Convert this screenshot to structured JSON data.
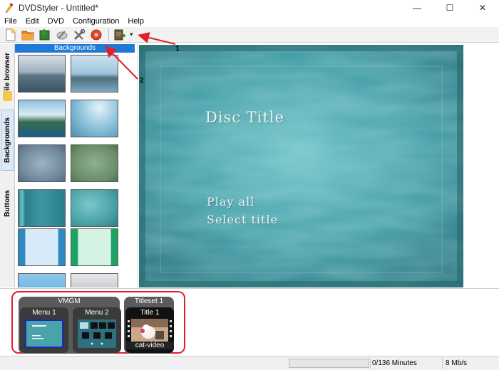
{
  "window": {
    "title": "DVDStyler - Untitled*"
  },
  "window_controls": {
    "minimize": "—",
    "maximize": "☐",
    "close": "✕"
  },
  "menu": [
    "File",
    "Edit",
    "DVD",
    "Configuration",
    "Help"
  ],
  "toolbar": {
    "buttons": [
      "new-file-icon",
      "open-folder-icon",
      "save-icon",
      "burn-disc-icon",
      "settings-tools-icon",
      "burn-dvd-icon",
      "add-video-icon"
    ],
    "dropdown_arrow": "▾"
  },
  "sidebar": {
    "tabs": [
      {
        "label": "File browser",
        "active": false
      },
      {
        "label": "Backgrounds",
        "active": true
      },
      {
        "label": "Buttons",
        "active": false
      }
    ]
  },
  "backgrounds_panel": {
    "header": "Backgrounds",
    "thumbnails": [
      "coast-cloudy",
      "coast-island",
      "green-shore",
      "blue-haze",
      "blue-gray-blur",
      "green-blur",
      "teal-stripes",
      "teal-texture",
      "light-blue-frame",
      "mint-green-frame",
      "blue-gradient",
      "gray-gradient"
    ]
  },
  "preview": {
    "disc_title": "Disc Title",
    "play_all": "Play all",
    "select_title": "Select title"
  },
  "titleset_manager": {
    "vmgm": {
      "label": "VMGM",
      "menus": [
        "Menu 1"
      ]
    },
    "titleset": {
      "label": "Titleset 1",
      "menus": [
        "Menu 2"
      ],
      "titles": [
        {
          "label": "Title 1",
          "file": "cat-video"
        }
      ]
    }
  },
  "status": {
    "progress_fraction": 0,
    "duration": "0/136 Minutes",
    "bitrate": "8 Mb/s"
  },
  "annotations": {
    "callout_1": "1",
    "callout_2": "2",
    "color": "#e0202a"
  }
}
